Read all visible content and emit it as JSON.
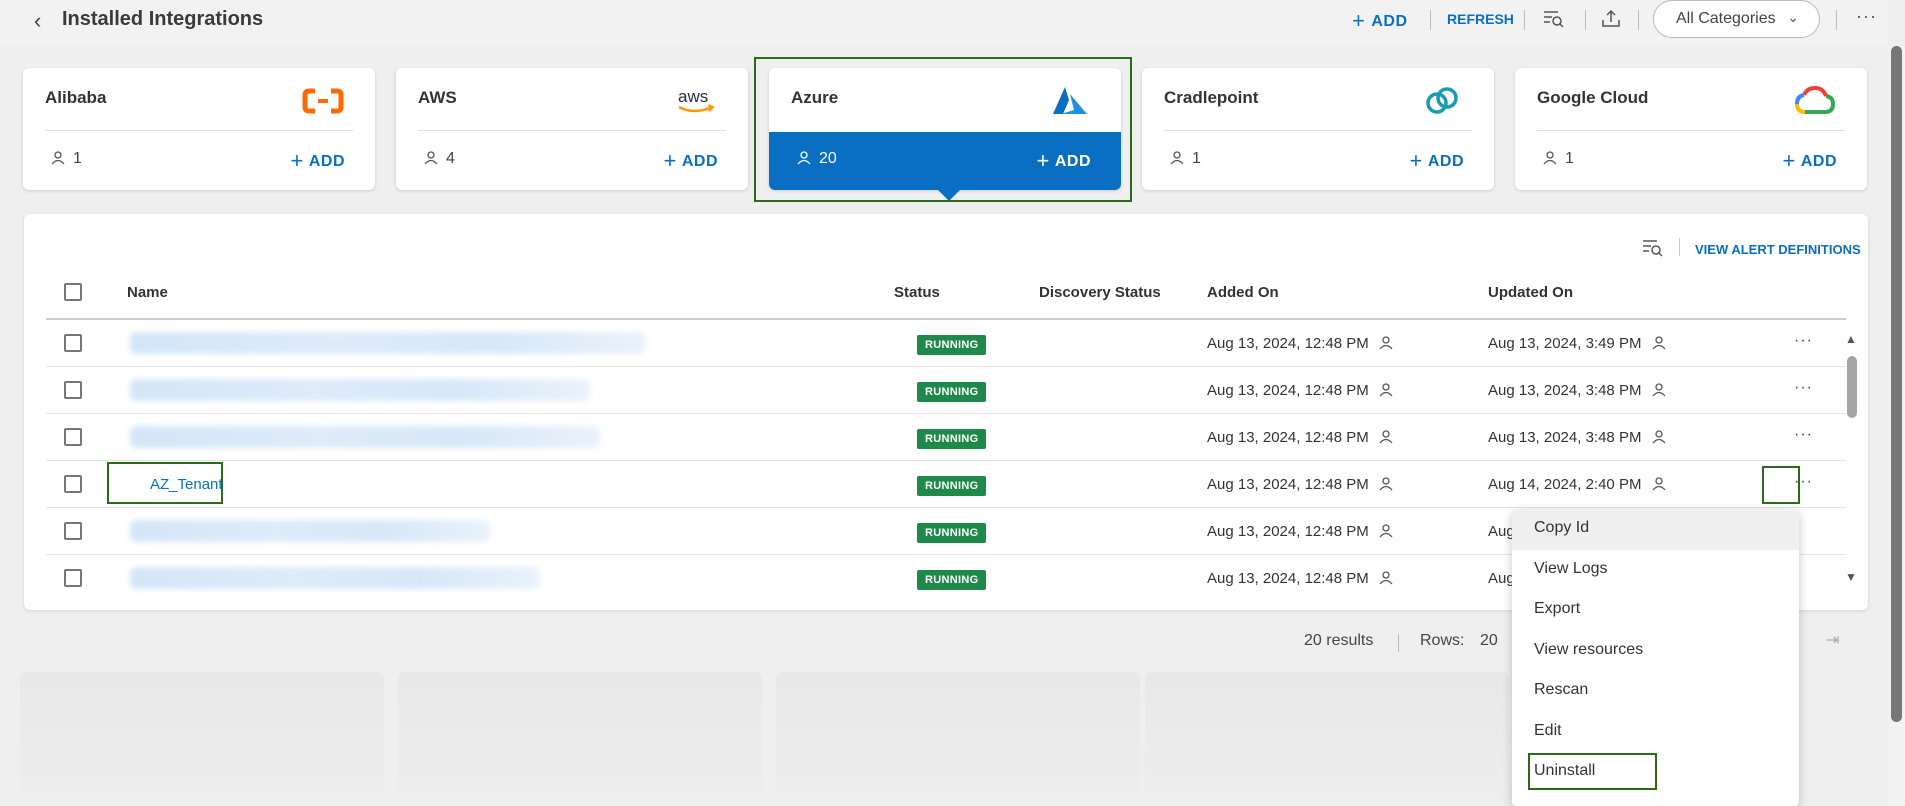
{
  "header": {
    "title": "Installed Integrations",
    "add_label": "ADD",
    "refresh_label": "REFRESH",
    "category_select": "All Categories"
  },
  "cards": [
    {
      "name": "Alibaba",
      "count": "1",
      "add_label": "ADD",
      "logo": "alibaba-logo"
    },
    {
      "name": "AWS",
      "count": "4",
      "add_label": "ADD",
      "logo": "aws-logo"
    },
    {
      "name": "Azure",
      "count": "20",
      "add_label": "ADD",
      "logo": "azure-logo",
      "selected": true
    },
    {
      "name": "Cradlepoint",
      "count": "1",
      "add_label": "ADD",
      "logo": "cradlepoint-logo"
    },
    {
      "name": "Google Cloud",
      "count": "1",
      "add_label": "ADD",
      "logo": "google-cloud-logo"
    }
  ],
  "panel": {
    "view_alert_label": "VIEW ALERT DEFINITIONS"
  },
  "table": {
    "columns": [
      "Name",
      "Status",
      "Discovery Status",
      "Added On",
      "Updated On"
    ],
    "rows": [
      {
        "name": "",
        "status": "RUNNING",
        "added": "Aug 13, 2024, 12:48 PM",
        "updated": "Aug 13, 2024, 3:49 PM"
      },
      {
        "name": "",
        "status": "RUNNING",
        "added": "Aug 13, 2024, 12:48 PM",
        "updated": "Aug 13, 2024, 3:48 PM"
      },
      {
        "name": "",
        "status": "RUNNING",
        "added": "Aug 13, 2024, 12:48 PM",
        "updated": "Aug 13, 2024, 3:48 PM"
      },
      {
        "name": "AZ_Tenant",
        "status": "RUNNING",
        "added": "Aug 13, 2024, 12:48 PM",
        "updated": "Aug 14, 2024, 2:40 PM"
      },
      {
        "name": "",
        "status": "RUNNING",
        "added": "Aug 13, 2024, 12:48 PM",
        "updated": "Aug"
      },
      {
        "name": "",
        "status": "RUNNING",
        "added": "Aug 13, 2024, 12:48 PM",
        "updated": "Aug"
      }
    ]
  },
  "footer": {
    "results": "20 results",
    "rows_label": "Rows:",
    "rows_value": "20"
  },
  "menu": {
    "items": [
      "Copy Id",
      "View Logs",
      "Export",
      "View resources",
      "Rescan",
      "Edit",
      "Uninstall"
    ]
  },
  "colors": {
    "accent": "#0a6fc2",
    "running": "#1e8a4a",
    "highlight": "#2b6a1a"
  }
}
